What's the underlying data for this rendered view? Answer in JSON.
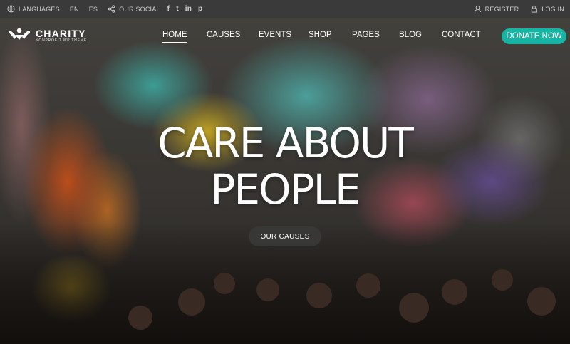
{
  "topbar": {
    "languages_label": "LANGUAGES",
    "lang_en": "EN",
    "lang_es": "ES",
    "social_label": "OUR SOCIAL",
    "social_icons": [
      "f",
      "t",
      "in",
      "p"
    ],
    "register_label": "REGISTER",
    "login_label": "LOG IN"
  },
  "header": {
    "logo_name": "CHARITY",
    "logo_tagline": "NONPROFIT WP THEME",
    "nav": [
      "HOME",
      "CAUSES",
      "EVENTS",
      "SHOP",
      "PAGES",
      "BLOG",
      "CONTACT"
    ],
    "active_nav": "HOME",
    "donate_label": "DONATE NOW"
  },
  "hero": {
    "headline_line1": "CARE ABOUT",
    "headline_line2": "PEOPLE",
    "cta_label": "OUR CAUSES"
  },
  "colors": {
    "topbar_bg": "#3a3a3a",
    "accent": "#17b3a3",
    "cta_bg": "#3a3a3a"
  }
}
